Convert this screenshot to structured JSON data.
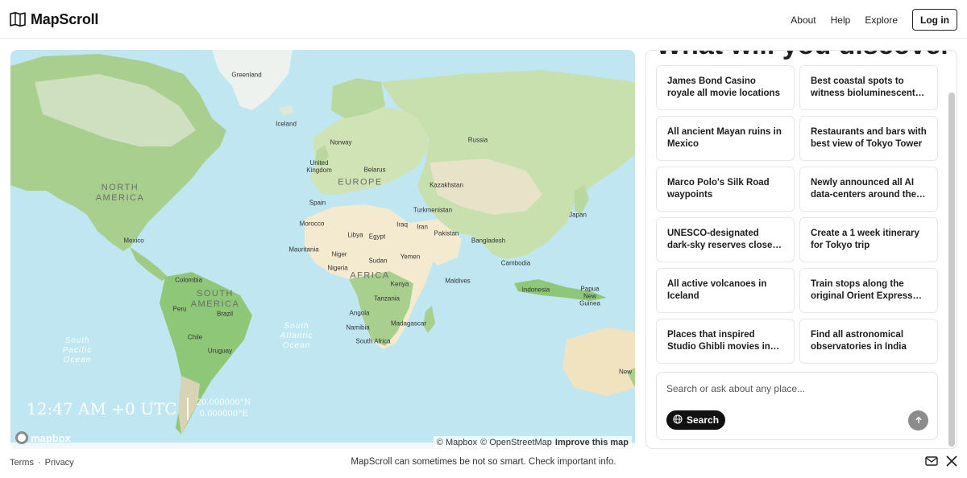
{
  "header": {
    "brand": "MapScroll",
    "nav": [
      "About",
      "Help",
      "Explore"
    ],
    "login": "Log in"
  },
  "map": {
    "labels": {
      "greenland": "Greenland",
      "iceland": "Iceland",
      "norway": "Norway",
      "russia": "Russia",
      "uk": "United Kingdom",
      "belarus": "Belarus",
      "europe": "EUROPE",
      "kazakhstan": "Kazakhstan",
      "north_america": "NORTH AMERICA",
      "spain": "Spain",
      "turkmenistan": "Turkmenistan",
      "japan": "Japan",
      "morocco": "Morocco",
      "libya": "Libya",
      "egypt": "Egypt",
      "iraq": "Iraq",
      "iran": "Iran",
      "pakistan": "Pakistan",
      "mexico": "Mexico",
      "bangladesh": "Bangladesh",
      "mauritania": "Mauritania",
      "niger": "Niger",
      "sudan": "Sudan",
      "yemen": "Yemen",
      "nigeria": "Nigeria",
      "cambodia": "Cambodia",
      "colombia": "Colombia",
      "maldives": "Maldives",
      "africa": "AFRICA",
      "kenya": "Kenya",
      "indonesia": "Indonesia",
      "papua": "Papua New Guinea",
      "south_america": "SOUTH AMERICA",
      "tanzania": "Tanzania",
      "peru": "Peru",
      "brazil": "Brazil",
      "madagascar": "Madagascar",
      "angola": "Angola",
      "namibia": "Namibia",
      "chile": "Chile",
      "south_africa": "South Africa",
      "uruguay": "Uruguay",
      "south_pacific_ocean": "South Pacific Ocean",
      "south_atlantic_ocean": "South Atlantic Ocean",
      "new": "New"
    },
    "clock_time": "12:47 AM +0 UTC",
    "coord_lat": "20.000000°N",
    "coord_lon": "0.000000°E",
    "mapbox_label": "mapbox",
    "attribution": [
      "© Mapbox",
      "© OpenStreetMap"
    ],
    "improve": "Improve this map"
  },
  "panel": {
    "heading": "What will you discover?",
    "cards": [
      "James Bond Casino royale all movie locations",
      "Best coastal spots to witness bioluminescent waves",
      "All ancient Mayan ruins in Mexico",
      "Restaurants and bars with best view of Tokyo Tower",
      "Marco Polo's Silk Road waypoints",
      "Newly announced all AI data-centers around the world",
      "UNESCO-designated dark-sky reserves close to major cities",
      "Create a 1 week itinerary for Tokyo trip",
      "All active volcanoes in Iceland",
      "Train stops along the original Orient Express route",
      "Places that inspired Studio Ghibli movies in Japan",
      "Find all astronomical observatories in India"
    ],
    "search_placeholder": "Search or ask about any place...",
    "search_label": "Search"
  },
  "footer": {
    "terms": "Terms",
    "separator": "·",
    "privacy": "Privacy",
    "disclaimer": "MapScroll can sometimes be not so smart. Check important info."
  },
  "colors": {
    "ocean": "#bfe6f1",
    "land": "#e8e2c8",
    "forest": "#a9cf8e",
    "desert": "#f3ead0"
  },
  "icons": [
    "map-logo-icon",
    "globe-icon",
    "arrow-up-icon",
    "mail-icon",
    "x-icon",
    "mapbox-icon"
  ]
}
